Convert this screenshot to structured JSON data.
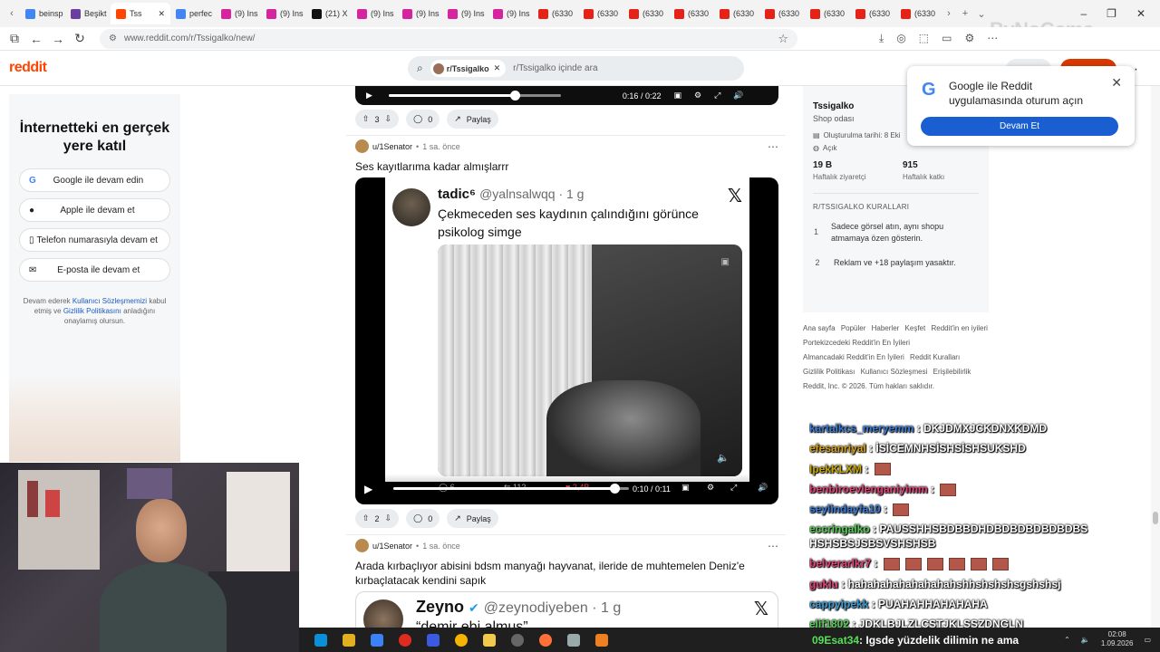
{
  "browser": {
    "tabs": [
      {
        "label": "beinsp",
        "color": "#4285f4"
      },
      {
        "label": "Beşikt",
        "color": "#6b3fa0"
      },
      {
        "label": "Tss",
        "color": "#ff4500",
        "active": true
      },
      {
        "label": "perfec",
        "color": "#4285f4"
      },
      {
        "label": "(9) Ins",
        "color": "#d6249f"
      },
      {
        "label": "(9) Ins",
        "color": "#d6249f"
      },
      {
        "label": "(21) X",
        "color": "#111111"
      },
      {
        "label": "(9) Ins",
        "color": "#d6249f"
      },
      {
        "label": "(9) Ins",
        "color": "#d6249f"
      },
      {
        "label": "(9) Ins",
        "color": "#d6249f"
      },
      {
        "label": "(9) Ins",
        "color": "#d6249f"
      },
      {
        "label": "(6330",
        "color": "#e62117"
      },
      {
        "label": "(6330",
        "color": "#e62117"
      },
      {
        "label": "(6330",
        "color": "#e62117"
      },
      {
        "label": "(6330",
        "color": "#e62117"
      },
      {
        "label": "(6330",
        "color": "#e62117"
      },
      {
        "label": "(6330",
        "color": "#e62117"
      },
      {
        "label": "(6330",
        "color": "#e62117"
      },
      {
        "label": "(6330",
        "color": "#e62117"
      },
      {
        "label": "(6330",
        "color": "#e62117"
      }
    ],
    "url": "www.reddit.com/r/Tssigalko/new/",
    "watermark": "ByNoGame"
  },
  "header": {
    "logo": "reddit",
    "search_chip": "r/Tssigalko",
    "search_placeholder": "r/Tssigalko içinde ara"
  },
  "left_panel": {
    "title": "İnternetteki en gerçek yere katıl",
    "buttons": [
      "Google ile devam edin",
      "Apple ile devam et",
      "Telefon numarasıyla devam et",
      "E-posta ile devam et"
    ],
    "legal_prefix": "Devam ederek",
    "legal_link1": "Kullanıcı Sözleşmemizi",
    "legal_mid": "kabul etmiş ve",
    "legal_link2": "Gizlilik Politikasını",
    "legal_suffix": "anladığını onaylamış olursun."
  },
  "top_video": {
    "time": "0:16 / 0:22",
    "progress": 0.73
  },
  "post1_actions": {
    "votes": "3",
    "comments": "0",
    "share": "Paylaş"
  },
  "post2": {
    "author": "u/1Senator",
    "time": "1 sa. önce",
    "title": "Ses kayıtlarıma kadar almışlarrr",
    "tweet_name": "tadic⁶",
    "tweet_handle": "@yalnsalwqq · 1 g",
    "tweet_text": "Çekmeceden ses kaydının çalındığını görünce psikolog simge",
    "tweet_stats": {
      "replies": "6",
      "retweets": "112",
      "likes": "2,4B"
    },
    "video_time": "0:10 / 0:11",
    "progress": 0.94,
    "votes": "2",
    "comments": "0",
    "share": "Paylaş"
  },
  "post3": {
    "author": "u/1Senator",
    "time": "1 sa. önce",
    "title": "Arada kırbaçlıyor abisini bdsm manyağı hayvanat, ileride de muhtemelen Deniz'e kırbaçlatacak kendini sapık",
    "tweet_name": "Zeyno",
    "tweet_handle": "@zeynodiyeben · 1 g",
    "tweet_text": "“demir ebi almuş”"
  },
  "community": {
    "name": "Tssigalko",
    "description": "Shop odası",
    "created": "Oluşturulma tarihi: 8 Eki",
    "status": "Açık",
    "visitors": "19 B",
    "visitors_label": "Haftalık ziyaretçi",
    "contributions": "915",
    "contributions_label": "Haftalık katkı",
    "rules_title": "R/TSSIGALKO KURALLARI",
    "rules": [
      {
        "n": "1",
        "text": "Sadece görsel atın, aynı shopu atmamaya özen gösterin."
      },
      {
        "n": "2",
        "text": "Reklam ve +18 paylaşım yasaktır."
      }
    ]
  },
  "footer_links": [
    "Ana sayfa",
    "Popüler",
    "Haberler",
    "Keşfet",
    "Reddit'in en iyileri",
    "Portekizcedeki Reddit'in En İyileri",
    "Almancadaki Reddit'in En İyileri",
    "Reddit Kuralları",
    "Gizlilik Politikası",
    "Kullanıcı Sözleşmesi",
    "Erişilebilirlik",
    "Reddit, Inc. © 2026. Tüm hakları saklıdır."
  ],
  "google_popup": {
    "text": "Google ile Reddit uygulamasında oturum açın",
    "button": "Devam Et"
  },
  "chat": [
    {
      "user": "kartalkcs_meryemm",
      "color": "#3a7bd5",
      "msg": "DKJDMXJCKDNXKDMD"
    },
    {
      "user": "efesanriyal",
      "color": "#d4a017",
      "msg": "İSİCEMNHSİSHSİSHSUKSHD"
    },
    {
      "user": "IpekKLXM",
      "color": "#c8a800",
      "msg": "",
      "emotes": 1
    },
    {
      "user": "benbiroevlenganiyimm",
      "color": "#e0447a",
      "msg": "",
      "emotes": 1
    },
    {
      "user": "seylindayfa10",
      "color": "#3a7bd5",
      "msg": "",
      "emotes": 1
    },
    {
      "user": "eccringalko",
      "color": "#55cc55",
      "msg": "PAUSSHHSBDBBDHDBDBDBDBDBDBS HSHSBSJSBSVSHSHSB"
    },
    {
      "user": "belverarlkr7",
      "color": "#e0447a",
      "msg": "",
      "emotes": 6
    },
    {
      "user": "guklu",
      "color": "#e0447a",
      "msg": "hahahahahahahahahshhshshshsgshshsj"
    },
    {
      "user": "cappyipekk",
      "color": "#3a9bd5",
      "msg": "PUAHAHHAHAHAHA"
    },
    {
      "user": "elif1802",
      "color": "#55cc55",
      "msg": "JDKLBJLZLCSTJKLŞSZDNGLN"
    }
  ],
  "taskbar": {
    "chat_user": "09Esat34",
    "chat_msg": "Igsde yüzdelik dilimin ne ama",
    "time": "02:08",
    "date": "1.09.2026"
  }
}
